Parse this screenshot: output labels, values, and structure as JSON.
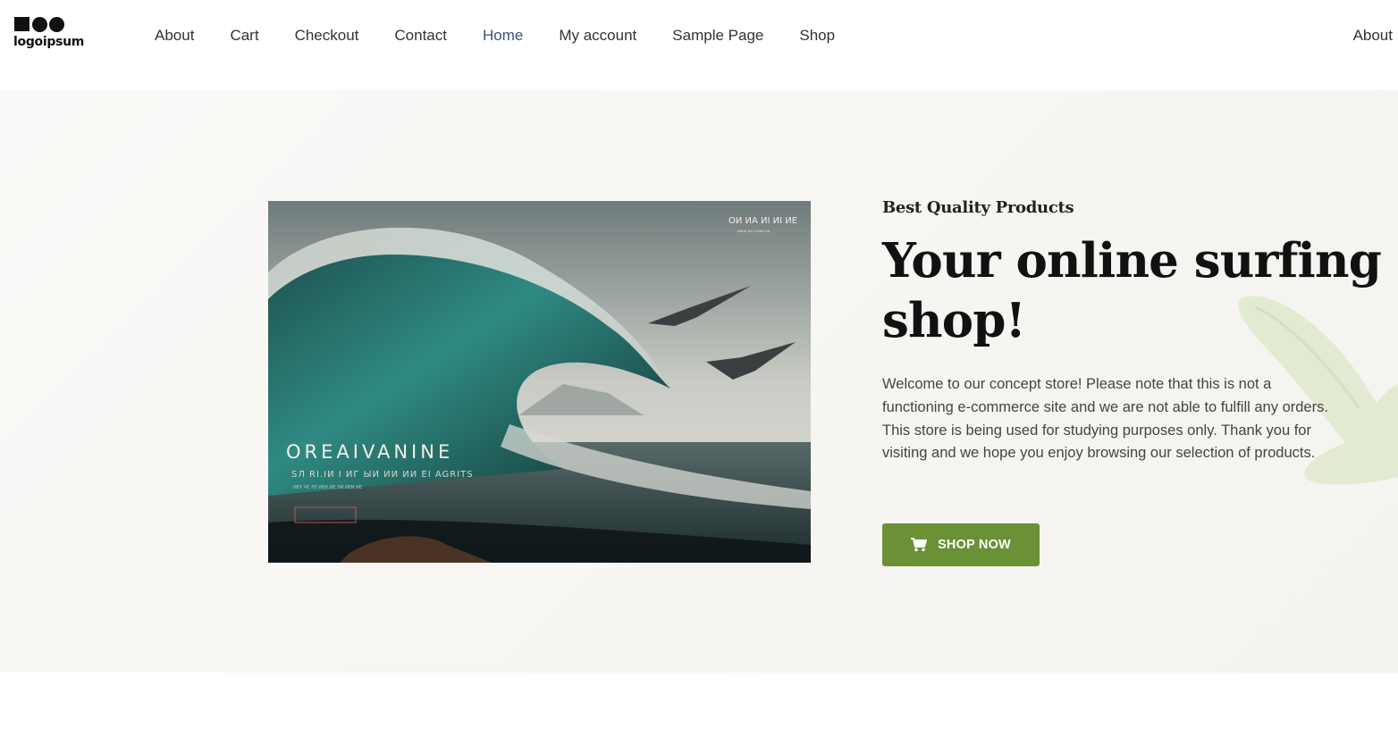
{
  "logo": {
    "text": "logoipsum"
  },
  "nav": {
    "items": [
      {
        "label": "About",
        "active": false
      },
      {
        "label": "Cart",
        "active": false
      },
      {
        "label": "Checkout",
        "active": false
      },
      {
        "label": "Contact",
        "active": false
      },
      {
        "label": "Home",
        "active": true
      },
      {
        "label": "My account",
        "active": false
      },
      {
        "label": "Sample Page",
        "active": false
      },
      {
        "label": "Shop",
        "active": false
      }
    ],
    "right_item": "About"
  },
  "hero": {
    "eyebrow": "Best Quality Products",
    "headline": "Your online surfing shop!",
    "intro": "Welcome to our concept store! Please note that this is not a functioning e-commerce site and we are not able to fulfill any orders. This store is being used for studying purposes only. Thank you for visiting and we hope you enjoy browsing our selection of products.",
    "button_label": "SHOP NOW",
    "button_icon": "cart-icon",
    "image": {
      "subject": "wave-with-birds-illustration",
      "title": "OREAIVANINE",
      "subtitle": "SЛ RI.IИ I ИГ ЫИ ИИ ИИ EI AGRITS",
      "caption": "ИЕУ ЧЕ ЛЕ ИЕИ ИЕ   ЛИ ИЕИ ИЕ",
      "corner_title": "OИ ИA ИI ИI ИE",
      "corner_sub": "ииии ии и  иии ии"
    }
  },
  "colors": {
    "accent": "#6a9135",
    "active_nav": "#36567a",
    "hero_bg": "#f7f5f1",
    "leaf": "#dfe8cc"
  }
}
